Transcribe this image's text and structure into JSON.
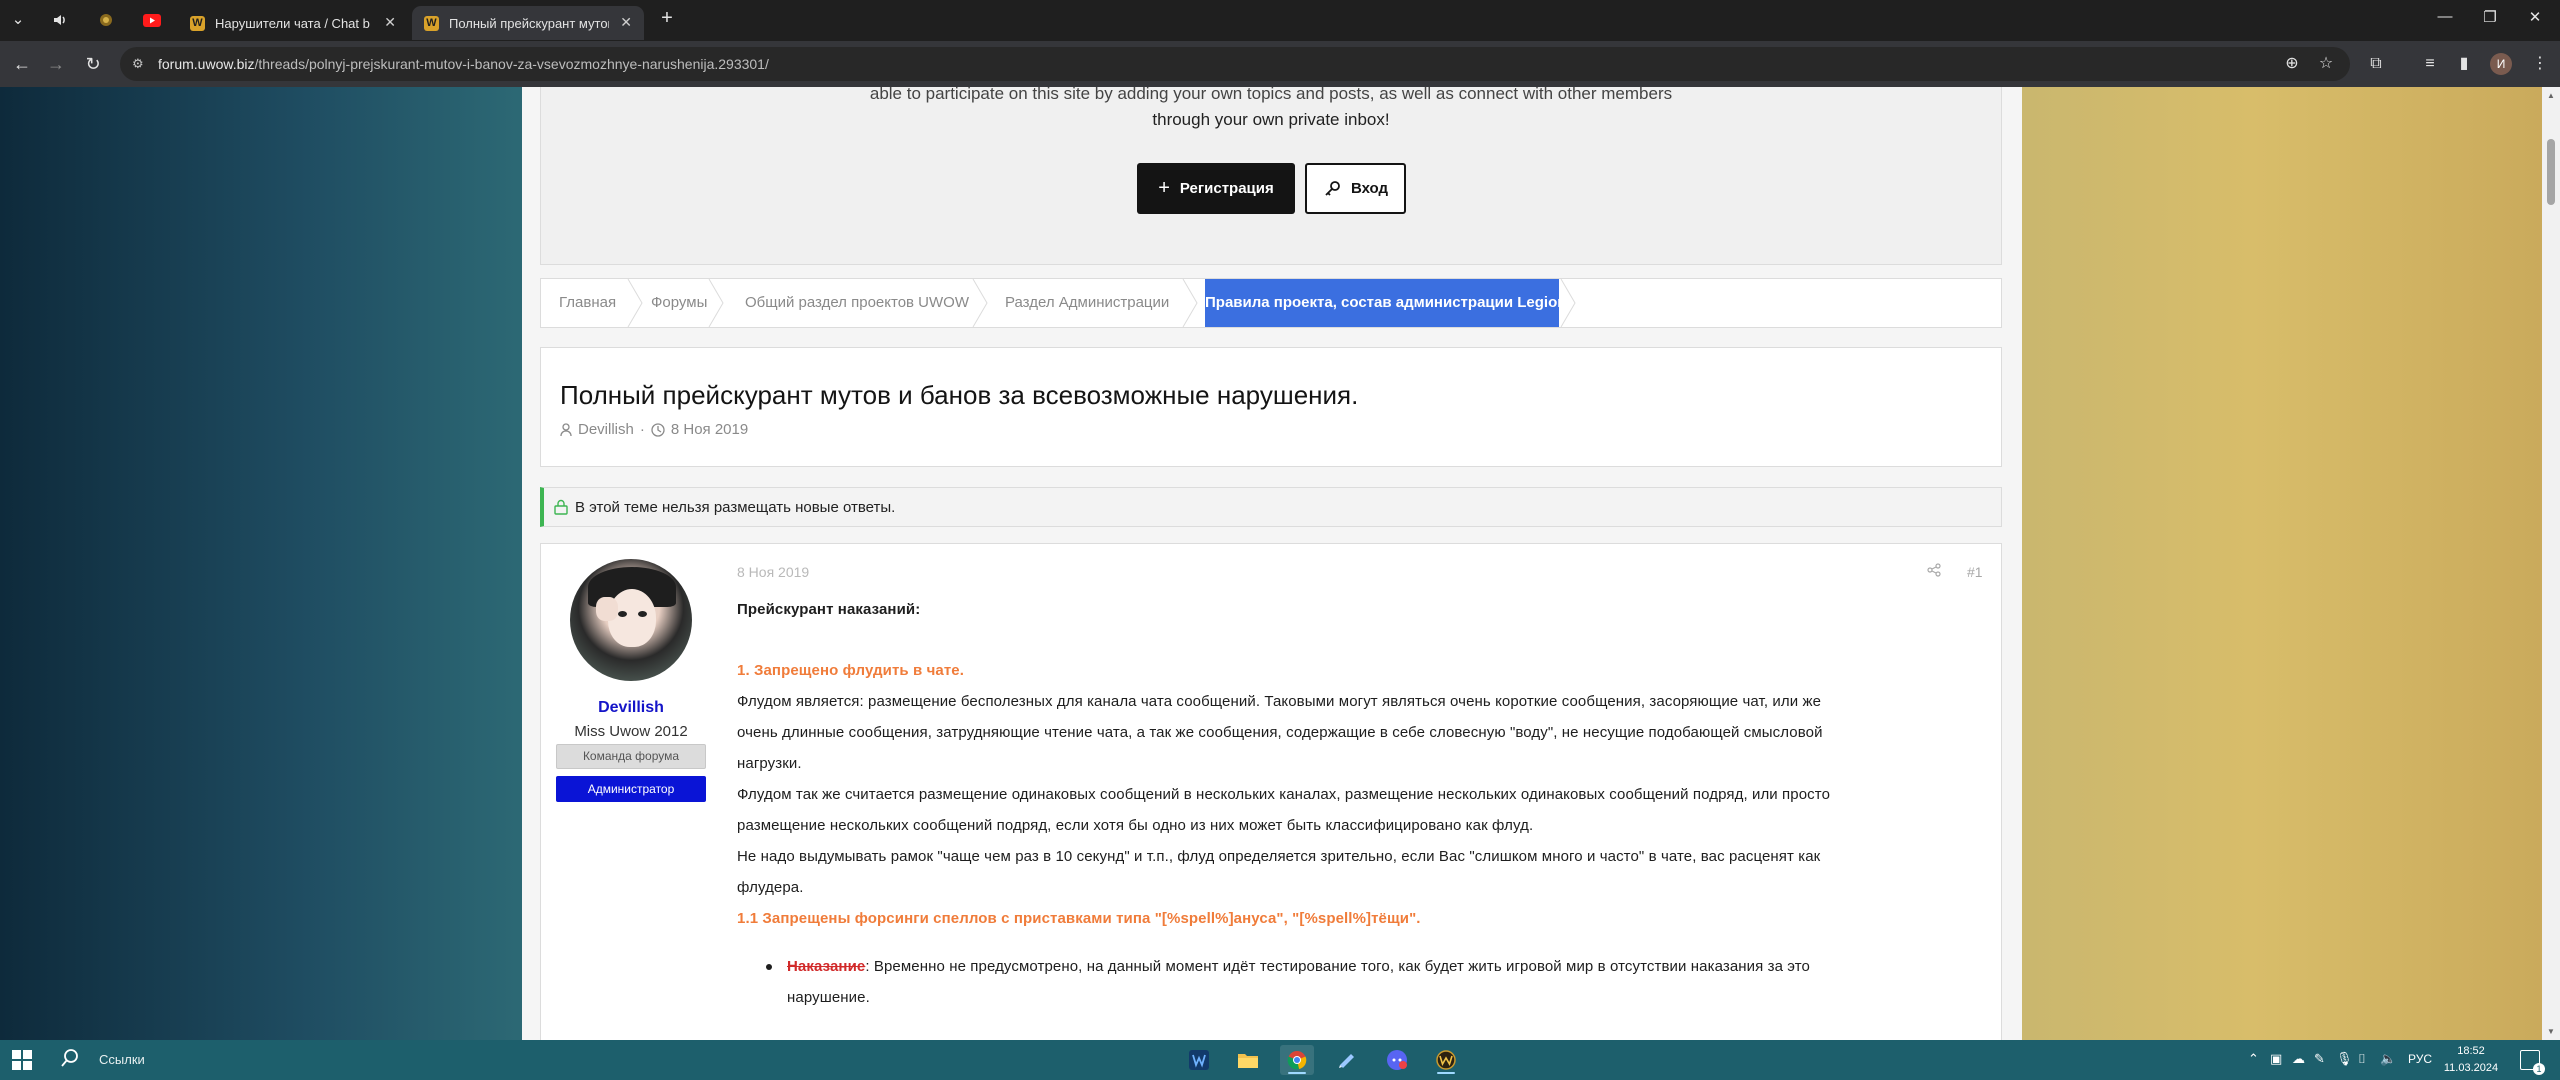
{
  "browser": {
    "tabs": [
      {
        "title": "Нарушители чата / Chat breakers",
        "active": false,
        "favicon": "W"
      },
      {
        "title": "Полный прейскурант мутов и банов",
        "active": true,
        "favicon": "W"
      }
    ],
    "url_host": "forum.uwow.biz",
    "url_path": "/threads/polnyj-prejskurant-mutov-i-banov-za-vsevozmozhnye-narushenija.293301/",
    "profile_initial": "И"
  },
  "guest": {
    "line1": "able to participate on this site by adding your own topics and posts, as well as connect with other members",
    "line2": "through your own private inbox!",
    "register_label": "Регистрация",
    "login_label": "Вход"
  },
  "breadcrumb": {
    "items": [
      "Главная",
      "Форумы",
      "Общий раздел проектов UWOW",
      "Раздел Администрации"
    ],
    "active": "Правила проекта, состав администрации Legion"
  },
  "thread": {
    "title": "Полный прейскурант мутов и банов за всевозможные нарушения.",
    "author": "Devillish",
    "date": "8 Ноя 2019"
  },
  "locked_notice": "В этой теме нельзя размещать новые ответы.",
  "post": {
    "date": "8 Ноя 2019",
    "number": "#1",
    "user": {
      "name": "Devillish",
      "title": "Miss Uwow 2012",
      "badge_team": "Команда форума",
      "badge_admin": "Администратор"
    },
    "heading": "Прейскурант наказаний:",
    "rule1": "1. Запрещено флудить в чате.",
    "p1_l1": "Флудом является: размещение бесполезных для канала чата сообщений. Таковыми могут являться очень короткие сообщения, засоряющие чат, или же",
    "p1_l2": "очень длинные сообщения, затрудняющие чтение чата, а так же сообщения, содержащие в себе словесную \"воду\", не несущие подобающей смысловой",
    "p1_l3": "нагрузки.",
    "p2_l1": "Флудом так же считается размещение одинаковых сообщений в нескольких каналах, размещение нескольких одинаковых сообщений подряд, или просто",
    "p2_l2": "размещение нескольких сообщений подряд, если хотя бы одно из них может быть классифицировано как флуд.",
    "p3_l1": "Не надо выдумывать рамок \"чаще чем раз в 10 секунд\" и т.п., флуд определяется зрительно, если Вас \"слишком много и часто\" в чате, вас расценят как",
    "p3_l2": "флудера.",
    "rule11": "1.1 Запрещены форсинги спеллов с приставками типа \"[%spell%]ануса\", \"[%spell%]тёщи\".",
    "punish_label": "Наказание",
    "punish_l1": ": Временно не предусмотрено, на данный момент идёт тестирование того, как будет жить игровой мир в отсутствии наказания за это",
    "punish_l2": "нарушение."
  },
  "taskbar": {
    "search_label": "Ссылки",
    "language": "РУС",
    "time": "18:52",
    "date": "11.03.2024",
    "notifications": "1"
  }
}
